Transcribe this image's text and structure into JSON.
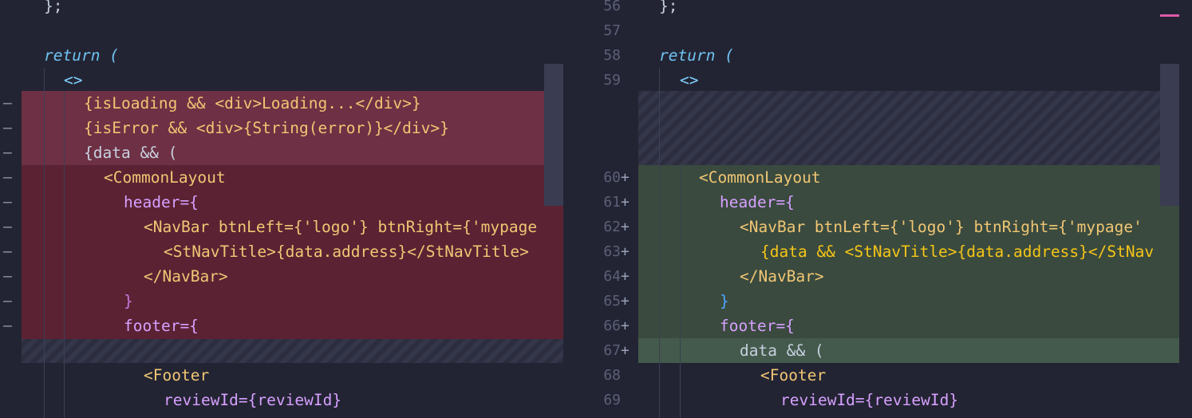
{
  "left": {
    "lines": [
      {
        "marker": "",
        "code": "};"
      },
      {
        "marker": "",
        "code": ""
      },
      {
        "marker": "",
        "code": "return ("
      },
      {
        "marker": "",
        "code": "<>"
      },
      {
        "marker": "—",
        "code": "{isLoading && <div>Loading...</div>}"
      },
      {
        "marker": "—",
        "code": "{isError && <div>{String(error)}</div>}"
      },
      {
        "marker": "—",
        "code": "{data && ("
      },
      {
        "marker": "—",
        "code": "<CommonLayout"
      },
      {
        "marker": "—",
        "code": "header={"
      },
      {
        "marker": "—",
        "code": "<NavBar btnLeft={'logo'} btnRight={'mypage"
      },
      {
        "marker": "—",
        "code": "<StNavTitle>{data.address}</StNavTitle>"
      },
      {
        "marker": "—",
        "code": "</NavBar>"
      },
      {
        "marker": "—",
        "code": "}"
      },
      {
        "marker": "—",
        "code": "footer={"
      },
      {
        "marker": "",
        "code": ""
      },
      {
        "marker": "",
        "code": "<Footer"
      },
      {
        "marker": "",
        "code": "reviewId={reviewId}"
      }
    ]
  },
  "right": {
    "lines": [
      {
        "num": "56",
        "marker": "",
        "code": "};"
      },
      {
        "num": "57",
        "marker": "",
        "code": ""
      },
      {
        "num": "58",
        "marker": "",
        "code": "return ("
      },
      {
        "num": "59",
        "marker": "",
        "code": "<>"
      },
      {
        "num": "60",
        "marker": "+",
        "code": "<CommonLayout"
      },
      {
        "num": "61",
        "marker": "+",
        "code": "header={"
      },
      {
        "num": "62",
        "marker": "+",
        "code": "<NavBar btnLeft={'logo'} btnRight={'mypage'"
      },
      {
        "num": "63",
        "marker": "+",
        "code": "{data && <StNavTitle>{data.address}</StNav"
      },
      {
        "num": "64",
        "marker": "+",
        "code": "</NavBar>"
      },
      {
        "num": "65",
        "marker": "+",
        "code": "}"
      },
      {
        "num": "66",
        "marker": "+",
        "code": "footer={"
      },
      {
        "num": "67",
        "marker": "+",
        "code": "data && ("
      },
      {
        "num": "68",
        "marker": "",
        "code": "<Footer"
      },
      {
        "num": "69",
        "marker": "",
        "code": "reviewId={reviewId}"
      }
    ]
  },
  "colors": {
    "background": "#232433",
    "deleted": "#5b2233",
    "added": "#3a4a3e",
    "keyword": "#6fc3f2",
    "tag": "#ff6b7a",
    "component": "#f0c674"
  }
}
